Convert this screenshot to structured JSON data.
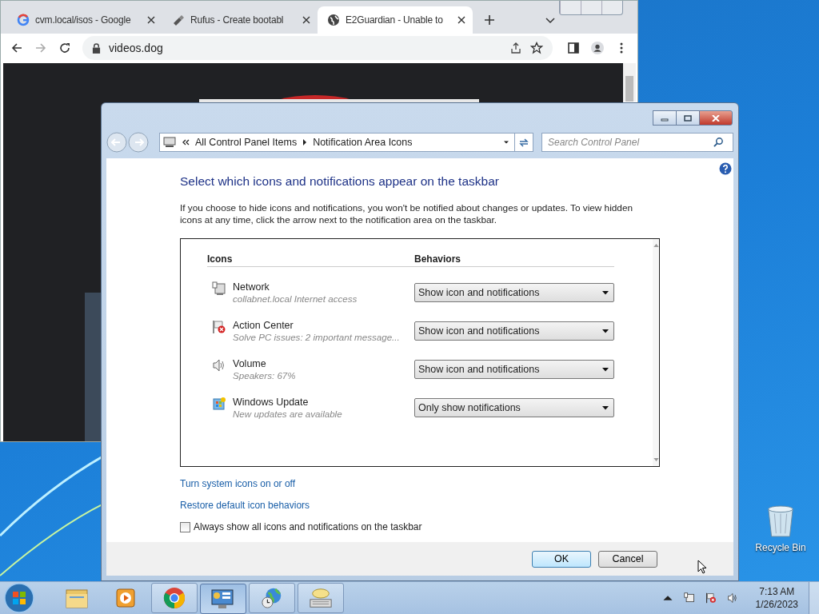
{
  "browser": {
    "tabs": [
      {
        "title": "cvm.local/isos - Google",
        "selected": false
      },
      {
        "title": "Rufus - Create bootabl",
        "selected": false
      },
      {
        "title": "E2Guardian - Unable to",
        "selected": true
      }
    ],
    "address": "videos.dog"
  },
  "dialog": {
    "breadcrumb": [
      "All Control Panel Items",
      "Notification Area Icons"
    ],
    "search": {
      "placeholder": "Search Control Panel"
    },
    "heading": "Select which icons and notifications appear on the taskbar",
    "description": "If you choose to hide icons and notifications, you won't be notified about changes or updates. To view hidden icons at any time, click the arrow next to the notification area on the taskbar.",
    "columns": [
      "Icons",
      "Behaviors"
    ],
    "rows": [
      {
        "name": "Network",
        "detail": "collabnet.local Internet access",
        "behavior": "Show icon and notifications"
      },
      {
        "name": "Action Center",
        "detail": "Solve PC issues: 2 important message...",
        "behavior": "Show icon and notifications"
      },
      {
        "name": "Volume",
        "detail": "Speakers: 67%",
        "behavior": "Show icon and notifications"
      },
      {
        "name": "Windows Update",
        "detail": "New updates are available",
        "behavior": "Only show notifications"
      }
    ],
    "links": [
      "Turn system icons on or off",
      "Restore default icon behaviors"
    ],
    "checkbox": {
      "label": "Always show all icons and notifications on the taskbar",
      "checked": false
    },
    "buttons": [
      {
        "label": "OK",
        "default": true
      },
      {
        "label": "Cancel",
        "default": false
      }
    ]
  },
  "desktop": {
    "icons": [
      {
        "label": "Recycle Bin"
      }
    ]
  },
  "taskbar": {
    "items": [
      {
        "kind": "explorer",
        "running": false,
        "selected": false
      },
      {
        "kind": "media",
        "running": false,
        "selected": false
      },
      {
        "kind": "chrome",
        "running": true,
        "selected": false
      },
      {
        "kind": "control",
        "running": true,
        "selected": true
      },
      {
        "kind": "globe",
        "running": true,
        "selected": false
      },
      {
        "kind": "keyboard",
        "running": true,
        "selected": false
      }
    ],
    "clock": {
      "time": "7:13 AM",
      "date": "1/26/2023"
    }
  }
}
